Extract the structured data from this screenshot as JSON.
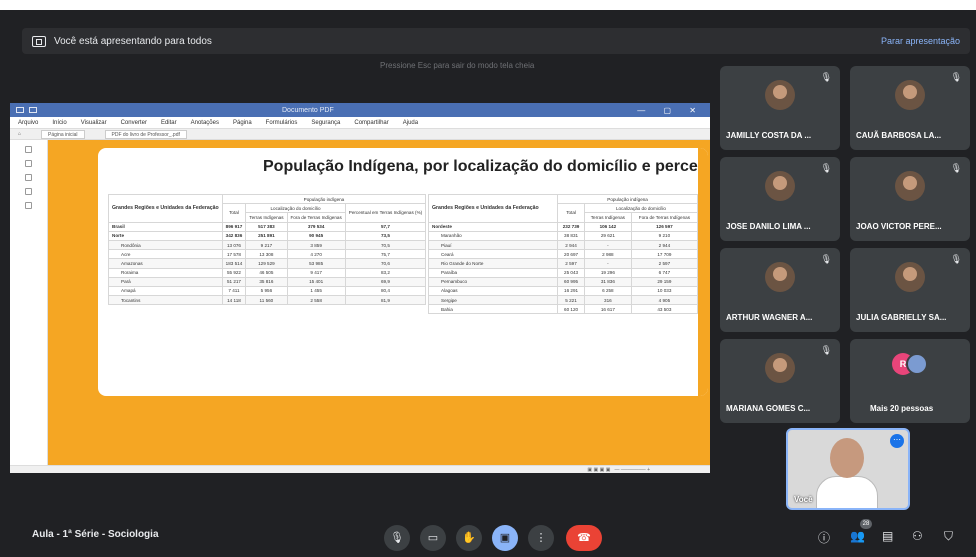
{
  "presentation_bar": {
    "message": "Você está apresentando para todos",
    "stop_label": "Parar apresentação",
    "hint": "Pressione  Esc  para sair do modo tela cheia"
  },
  "pdf": {
    "window_title": "Documento PDF",
    "menu": [
      "Arquivo",
      "Início",
      "Visualizar",
      "Converter",
      "Editar",
      "Anotações",
      "Página",
      "Formulários",
      "Segurança",
      "Compartilhar",
      "Ajuda"
    ],
    "tabs": [
      "Página inicial",
      "PDF do livro de Professor_.pdf"
    ],
    "doc_title": "População Indígena, por localização do domicílio e percentual r",
    "table1": {
      "col_region": "Grandes Regiões e Unidades da Federação",
      "group_header": "População indígena",
      "sub_group": "Localização do domicílio",
      "col_total": "Total",
      "col_ti": "Terras Indígenas",
      "col_fti": "Fora de Terras Indígenas",
      "col_pct": "Percentual em Terras Indígenas (%)",
      "rows": [
        {
          "name": "Brasil",
          "total": "896 917",
          "ti": "517 383",
          "fti": "379 534",
          "pct": "57,7",
          "bold": true
        },
        {
          "name": "Norte",
          "total": "342 836",
          "ti": "251 891",
          "fti": "90 945",
          "pct": "73,5",
          "bold": true
        },
        {
          "name": "Rondônia",
          "total": "13 076",
          "ti": "9 217",
          "fti": "3 859",
          "pct": "70,5"
        },
        {
          "name": "Acre",
          "total": "17 578",
          "ti": "13 308",
          "fti": "4 270",
          "pct": "75,7"
        },
        {
          "name": "Amazonas",
          "total": "183 514",
          "ti": "129 529",
          "fti": "53 985",
          "pct": "70,6"
        },
        {
          "name": "Roraima",
          "total": "55 922",
          "ti": "46 505",
          "fti": "9 417",
          "pct": "83,2"
        },
        {
          "name": "Pará",
          "total": "51 217",
          "ti": "35 816",
          "fti": "15 401",
          "pct": "69,9"
        },
        {
          "name": "Amapá",
          "total": "7 411",
          "ti": "5 956",
          "fti": "1 455",
          "pct": "80,4"
        },
        {
          "name": "Tocantins",
          "total": "14 118",
          "ti": "11 560",
          "fti": "2 558",
          "pct": "81,9"
        }
      ]
    },
    "table2": {
      "col_region": "Grandes Regiões e Unidades da Federação",
      "group_header": "População indígena",
      "sub_group": "Localização do domicílio",
      "col_total": "Total",
      "col_ti": "Terras Indígenas",
      "col_fti": "Fora de Terras Indígenas",
      "rows": [
        {
          "name": "Nordeste",
          "total": "232 739",
          "ti": "106 142",
          "fti": "126 597",
          "bold": true
        },
        {
          "name": "Maranhão",
          "total": "38 831",
          "ti": "29 621",
          "fti": "9 210"
        },
        {
          "name": "Piauí",
          "total": "2 944",
          "ti": "-",
          "fti": "2 944"
        },
        {
          "name": "Ceará",
          "total": "20 697",
          "ti": "2 988",
          "fti": "17 709"
        },
        {
          "name": "Rio Grande do Norte",
          "total": "2 597",
          "ti": "-",
          "fti": "2 597"
        },
        {
          "name": "Paraíba",
          "total": "25 043",
          "ti": "19 296",
          "fti": "6 747"
        },
        {
          "name": "Pernambuco",
          "total": "60 995",
          "ti": "31 836",
          "fti": "29 159"
        },
        {
          "name": "Alagoas",
          "total": "16 291",
          "ti": "6 258",
          "fti": "10 033"
        },
        {
          "name": "Sergipe",
          "total": "5 221",
          "ti": "316",
          "fti": "4 905"
        },
        {
          "name": "Bahia",
          "total": "60 120",
          "ti": "16 617",
          "fti": "43 503"
        }
      ]
    }
  },
  "participants": [
    {
      "name": "JAMILLY COSTA DA ..."
    },
    {
      "name": "CAUÃ BARBOSA LA..."
    },
    {
      "name": "JOSE DANILO LIMA ..."
    },
    {
      "name": "JOAO VICTOR PERE..."
    },
    {
      "name": "ARTHUR WAGNER A..."
    },
    {
      "name": "JULIA GABRIELLY SA..."
    },
    {
      "name": "MARIANA GOMES C..."
    },
    {
      "name": "Mais 20 pessoas"
    }
  ],
  "more_avatar_initial": "R",
  "self_label": "Você",
  "meeting_name": "Aula - 1ª Série - Sociologia",
  "people_count": "28"
}
